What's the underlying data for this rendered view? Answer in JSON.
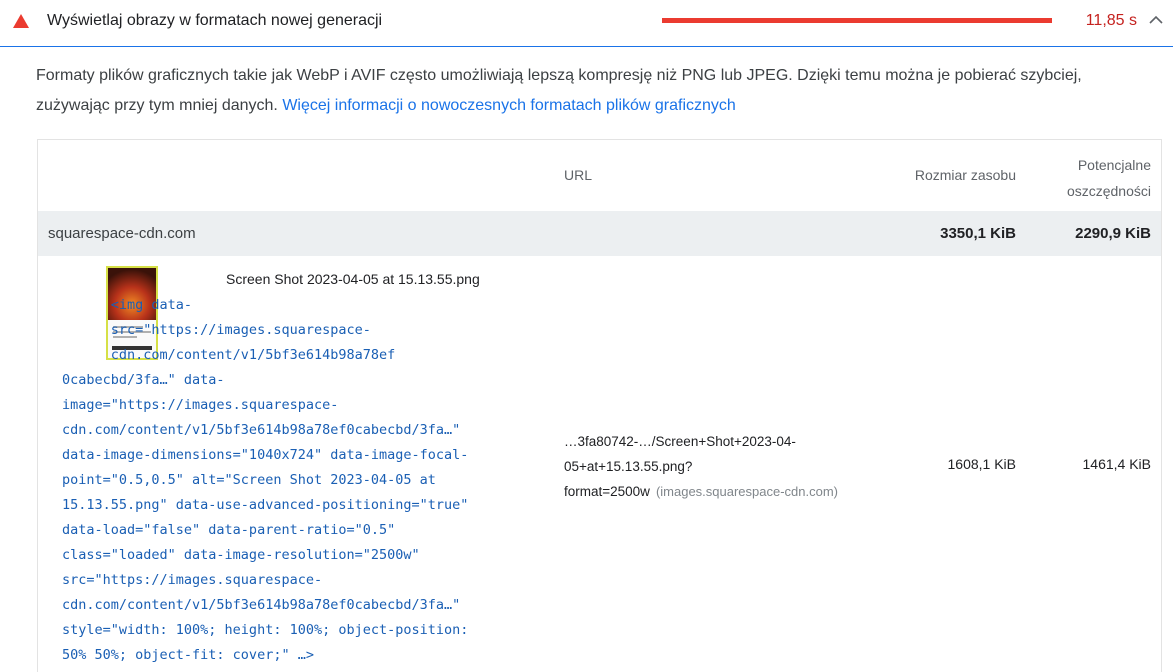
{
  "audit": {
    "title": "Wyświetlaj obrazy w formatach nowej generacji",
    "savings_display": "11,85 s",
    "status": "fail",
    "savings_fraction": 1.0,
    "colors": {
      "fail": "#eb3b30",
      "link": "#1a73e8",
      "code": "#1a5fb4"
    },
    "icons": {
      "status": "warning-triangle-icon",
      "toggle": "chevron-up-icon"
    }
  },
  "description": {
    "text": "Formaty plików graficznych takie jak WebP i AVIF często umożliwiają lepszą kompresję niż PNG lub JPEG. Dzięki temu można je pobierać szybciej, zużywając przy tym mniej danych. ",
    "link_text": "Więcej informacji o nowoczesnych formatach plików graficznych"
  },
  "table": {
    "headers": {
      "url": "URL",
      "resource_size": "Rozmiar zasobu",
      "potential_savings": "Potencjalne oszczędności"
    },
    "group": {
      "domain": "squarespace-cdn.com",
      "resource_size": "3350,1 KiB",
      "potential_savings": "2290,9 KiB"
    },
    "rows": [
      {
        "file_name": "Screen Shot 2023-04-05 at 15.13.55.png",
        "snippet": "<img data-src=\"https://images.squarespace-cdn.com/content/v1/5bf3e614b98a78ef0cabecbd/3fa…\" data-image=\"https://images.squarespace-cdn.com/content/v1/5bf3e614b98a78ef0cabecbd/3fa…\" data-image-dimensions=\"1040x724\" data-image-focal-point=\"0.5,0.5\" alt=\"Screen Shot 2023-04-05 at 15.13.55.png\" data-use-advanced-positioning=\"true\" data-load=\"false\" data-parent-ratio=\"0.5\" class=\"loaded\" data-image-resolution=\"2500w\" src=\"https://images.squarespace-cdn.com/content/v1/5bf3e614b98a78ef0cabecbd/3fa…\" style=\"width: 100%; height: 100%; object-position: 50% 50%; object-fit: cover;\" …>",
        "snippet_lines": [
          "      <img data-",
          "      src=\"https://images.squarespace-",
          "      cdn.com/content/v1/5bf3e614b98a78ef",
          "0cabecbd/3fa…\" data-",
          "image=\"https://images.squarespace-",
          "cdn.com/content/v1/5bf3e614b98a78ef0cabecbd/3fa…\"",
          "data-image-dimensions=\"1040x724\" data-image-focal-",
          "point=\"0.5,0.5\" alt=\"Screen Shot 2023-04-05 at",
          "15.13.55.png\" data-use-advanced-positioning=\"true\"",
          "data-load=\"false\" data-parent-ratio=\"0.5\"",
          "class=\"loaded\" data-image-resolution=\"2500w\"",
          "src=\"https://images.squarespace-",
          "cdn.com/content/v1/5bf3e614b98a78ef0cabecbd/3fa…\"",
          "style=\"width: 100%; height: 100%; object-position:",
          "50% 50%; object-fit: cover;\" …>"
        ],
        "url": "…3fa80742-…/Screen+Shot+2023-04-05+at+15.13.55.png?format=2500w",
        "url_lines": [
          "…3fa80742-…/Screen+Shot+2023-04-",
          "05+at+15.13.55.png?",
          "format=2500w"
        ],
        "url_host": "(images.squarespace-cdn.com)",
        "resource_size": "1608,1 KiB",
        "potential_savings": "1461,4 KiB",
        "thumbnail": "image-thumbnail"
      }
    ]
  }
}
